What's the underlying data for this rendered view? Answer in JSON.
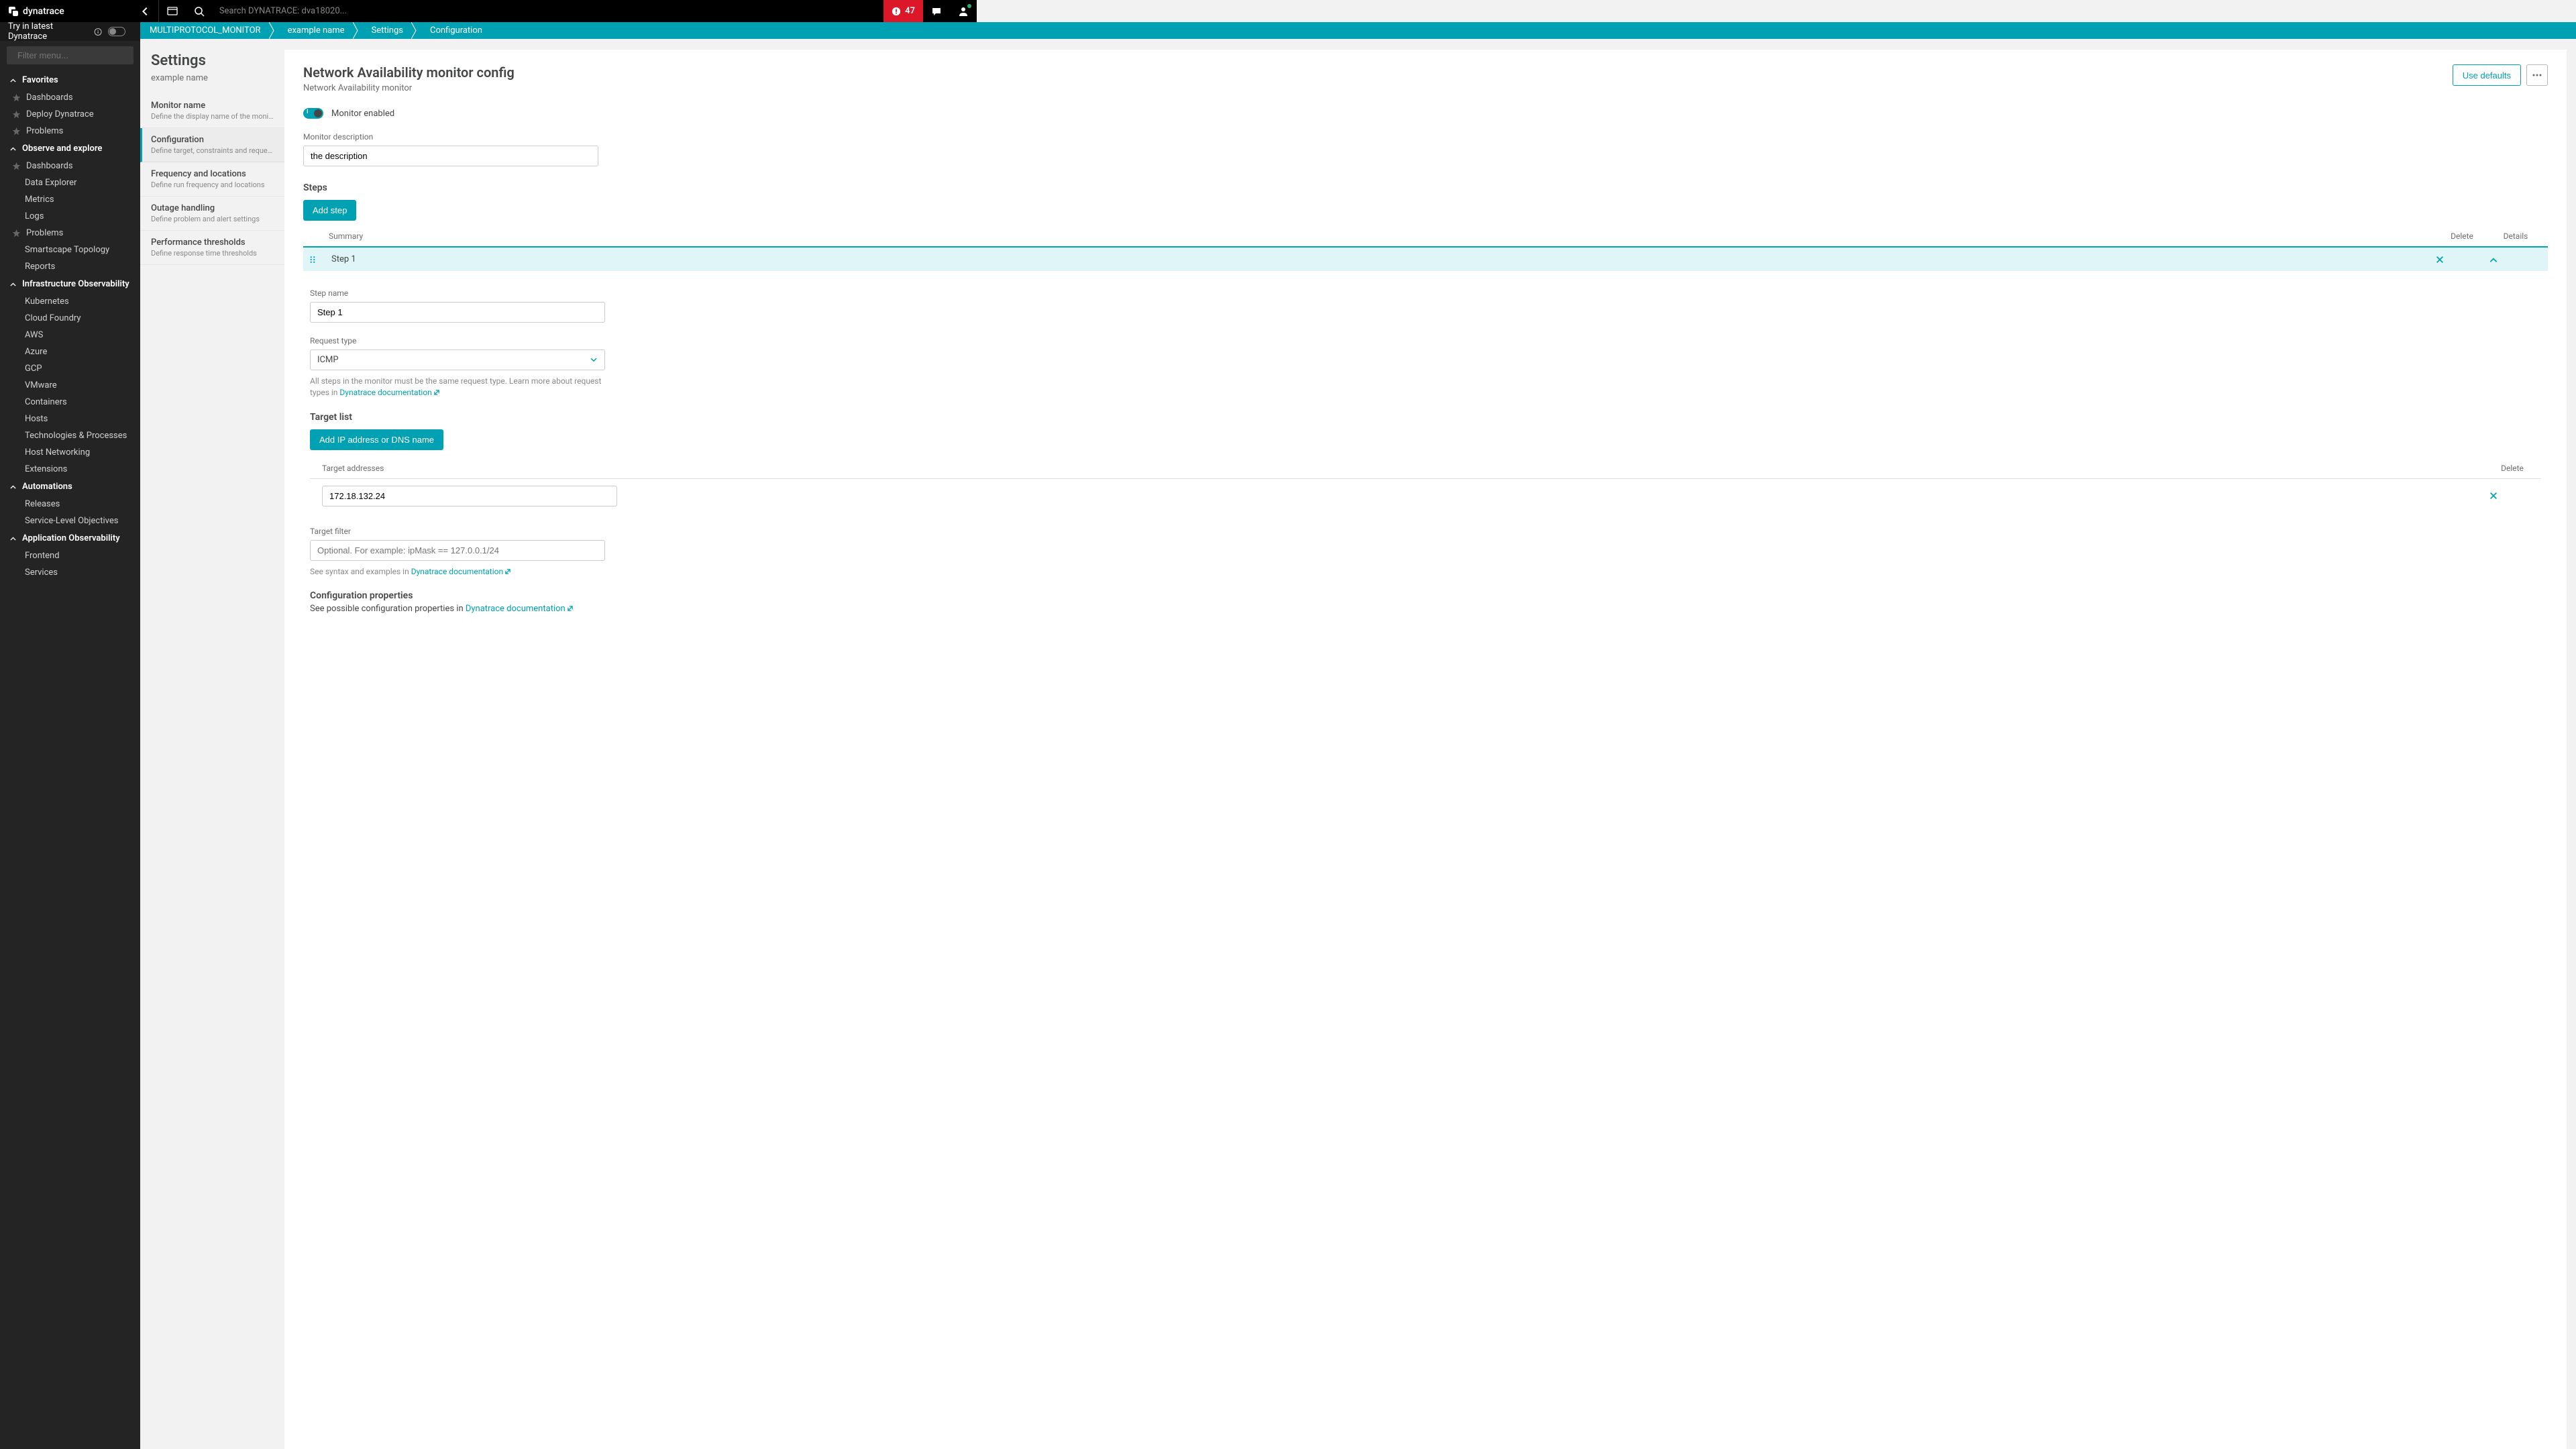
{
  "topbar": {
    "brand": "dynatrace",
    "search_placeholder": "Search DYNATRACE: dva18020...",
    "alert_count": "47"
  },
  "try_row": {
    "label": "Try in latest Dynatrace"
  },
  "sidebar": {
    "filter_placeholder": "Filter menu...",
    "sections": [
      {
        "title": "Favorites",
        "items": [
          {
            "label": "Dashboards",
            "star": true
          },
          {
            "label": "Deploy Dynatrace",
            "star": true
          },
          {
            "label": "Problems",
            "star": true
          }
        ]
      },
      {
        "title": "Observe and explore",
        "items": [
          {
            "label": "Dashboards",
            "star": true
          },
          {
            "label": "Data Explorer"
          },
          {
            "label": "Metrics"
          },
          {
            "label": "Logs"
          },
          {
            "label": "Problems",
            "star": true
          },
          {
            "label": "Smartscape Topology"
          },
          {
            "label": "Reports"
          }
        ]
      },
      {
        "title": "Infrastructure Observability",
        "items": [
          {
            "label": "Kubernetes"
          },
          {
            "label": "Cloud Foundry"
          },
          {
            "label": "AWS"
          },
          {
            "label": "Azure"
          },
          {
            "label": "GCP"
          },
          {
            "label": "VMware"
          },
          {
            "label": "Containers"
          },
          {
            "label": "Hosts"
          },
          {
            "label": "Technologies & Processes"
          },
          {
            "label": "Host Networking"
          },
          {
            "label": "Extensions"
          }
        ]
      },
      {
        "title": "Automations",
        "items": [
          {
            "label": "Releases"
          },
          {
            "label": "Service-Level Objectives"
          }
        ]
      },
      {
        "title": "Application Observability",
        "items": [
          {
            "label": "Frontend"
          },
          {
            "label": "Services"
          }
        ]
      }
    ]
  },
  "breadcrumb": {
    "items": [
      "MULTIPROTOCOL_MONITOR",
      "example name",
      "Settings",
      "Configuration"
    ]
  },
  "settings_side": {
    "title": "Settings",
    "subtitle": "example name",
    "items": [
      {
        "title": "Monitor name",
        "desc": "Define the display name of the monitor"
      },
      {
        "title": "Configuration",
        "desc": "Define target, constraints and request config...",
        "active": true
      },
      {
        "title": "Frequency and locations",
        "desc": "Define run frequency and locations"
      },
      {
        "title": "Outage handling",
        "desc": "Define problem and alert settings"
      },
      {
        "title": "Performance thresholds",
        "desc": "Define response time thresholds"
      }
    ]
  },
  "content": {
    "title": "Network Availability monitor config",
    "subtitle": "Network Availability monitor",
    "use_defaults": "Use defaults",
    "monitor_enabled_label": "Monitor enabled",
    "desc_label": "Monitor description",
    "desc_value": "the description",
    "steps_heading": "Steps",
    "add_step": "Add step",
    "table_headers": {
      "summary": "Summary",
      "delete": "Delete",
      "details": "Details"
    },
    "step_row": {
      "summary": "Step 1"
    },
    "step_detail": {
      "step_name_label": "Step name",
      "step_name_value": "Step 1",
      "request_type_label": "Request type",
      "request_type_value": "ICMP",
      "request_type_helper_pre": "All steps in the monitor must be the same request type. Learn more about request types in ",
      "request_type_helper_link": "Dynatrace documentation",
      "target_list_heading": "Target list",
      "add_target": "Add IP address or DNS name",
      "target_headers": {
        "addr": "Target addresses",
        "del": "Delete"
      },
      "target_value": "172.18.132.24",
      "target_filter_label": "Target filter",
      "target_filter_placeholder": "Optional. For example: ipMask == 127.0.0.1/24",
      "target_filter_helper_pre": "See syntax and examples in ",
      "target_filter_helper_link": "Dynatrace documentation",
      "config_props_heading": "Configuration properties",
      "config_props_text_pre": "See possible configuration properties in ",
      "config_props_text_link": "Dynatrace documentation"
    }
  }
}
